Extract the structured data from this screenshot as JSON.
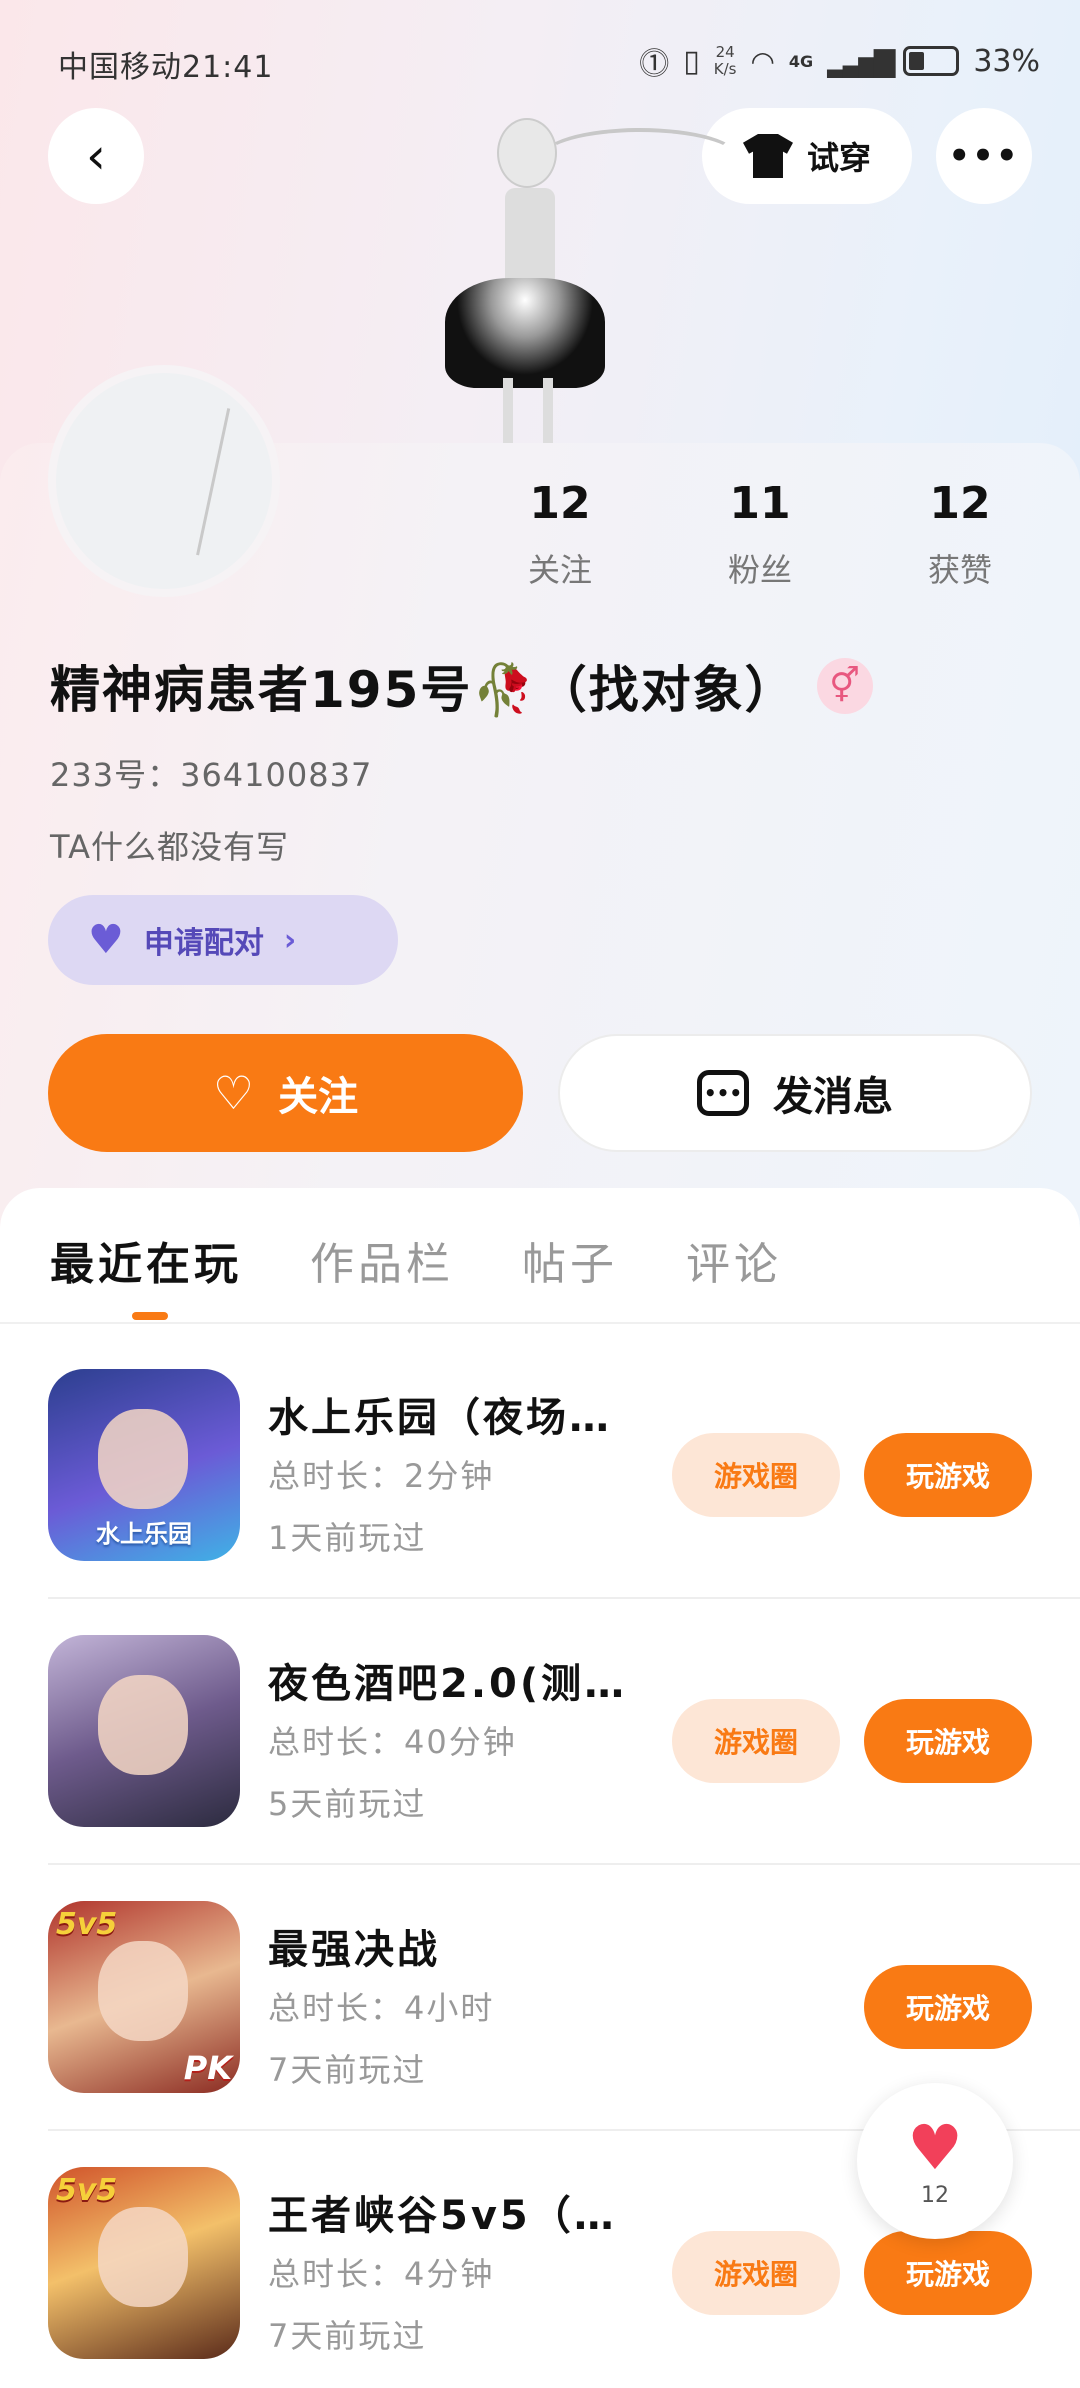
{
  "status_bar": {
    "carrier_time": "中国移动21:41",
    "net_speed_value": "24",
    "net_speed_unit": "K/s",
    "network": "4G",
    "battery": "33%"
  },
  "header": {
    "back_icon": "chevron-left-icon",
    "try_on_label": "试穿",
    "more_icon": "more-dots-icon"
  },
  "profile": {
    "stats": [
      {
        "value": "12",
        "label": "关注"
      },
      {
        "value": "11",
        "label": "粉丝"
      },
      {
        "value": "12",
        "label": "获赞"
      }
    ],
    "name": "精神病患者195号🥀（找对象）",
    "gender_symbol": "⚥",
    "id_line": "233号：364100837",
    "bio": "TA什么都没有写",
    "pair_label": "申请配对"
  },
  "actions": {
    "follow_label": "关注",
    "message_label": "发消息"
  },
  "tabs": [
    {
      "label": "最近在玩",
      "active": true
    },
    {
      "label": "作品栏",
      "active": false
    },
    {
      "label": "帖子",
      "active": false
    },
    {
      "label": "评论",
      "active": false
    }
  ],
  "games": [
    {
      "title": "水上乐园（夜场…",
      "duration": "总时长：2分钟",
      "last_played": "1天前玩过",
      "circle_label": "游戏圈",
      "play_label": "玩游戏",
      "icon_text": "水上乐园"
    },
    {
      "title": "夜色酒吧2.0(测…",
      "duration": "总时长：40分钟",
      "last_played": "5天前玩过",
      "circle_label": "游戏圈",
      "play_label": "玩游戏"
    },
    {
      "title": "最强决战",
      "duration": "总时长：4小时",
      "last_played": "7天前玩过",
      "play_label": "玩游戏",
      "icon_badge": "5v5",
      "icon_pk": "PK"
    },
    {
      "title": "王者峡谷5v5（…",
      "duration": "总时长：4分钟",
      "last_played": "7天前玩过",
      "circle_label": "游戏圈",
      "play_label": "玩游戏",
      "icon_badge": "5v5"
    }
  ],
  "fab": {
    "icon": "heart-icon",
    "count": "12"
  },
  "colors": {
    "accent": "#f97a14",
    "accent_light": "#fde6d6",
    "pair_bg": "#ddd8f3",
    "pair_text": "#5549b8"
  }
}
